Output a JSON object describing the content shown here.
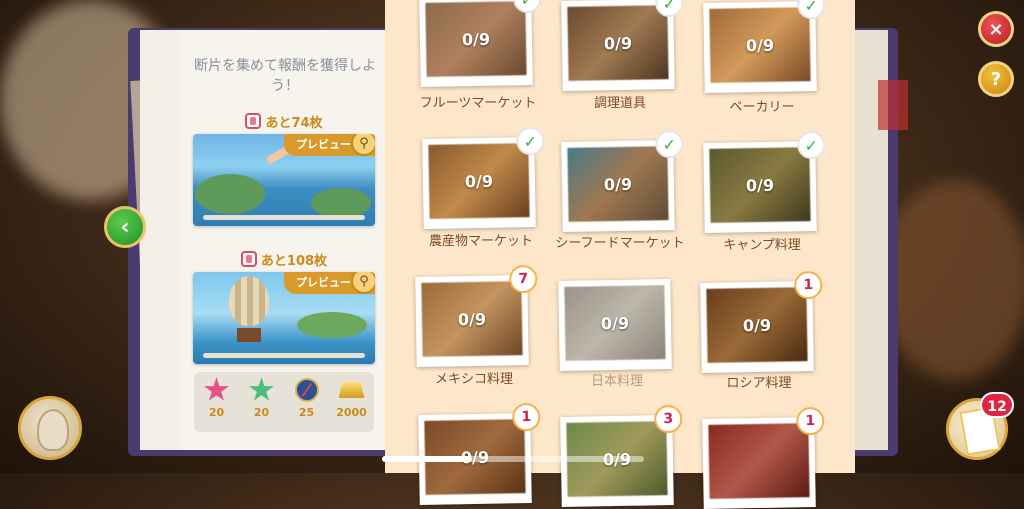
{
  "left_panel": {
    "heading": "断片を集めて報酬を獲得しよう！",
    "rewards": [
      {
        "remaining": "あと74枚",
        "preview_label": "プレビュー"
      },
      {
        "remaining": "あと108枚",
        "preview_label": "プレビュー"
      }
    ],
    "stats": [
      {
        "icon": "pink-star-icon",
        "value": "20"
      },
      {
        "icon": "green-star-icon",
        "value": "20"
      },
      {
        "icon": "compass-icon",
        "value": "25"
      },
      {
        "icon": "gold-bar-icon",
        "value": "2000"
      }
    ]
  },
  "album": {
    "tiles": [
      {
        "label": "フルーツマーケット",
        "count": "0/9",
        "badge": "check"
      },
      {
        "label": "調理道具",
        "count": "0/9",
        "badge": "check"
      },
      {
        "label": "ベーカリー",
        "count": "0/9",
        "badge": "check"
      },
      {
        "label": "農産物マーケット",
        "count": "0/9",
        "badge": "check"
      },
      {
        "label": "シーフードマーケット",
        "count": "0/9",
        "badge": "check"
      },
      {
        "label": "キャンプ料理",
        "count": "0/9",
        "badge": "check"
      },
      {
        "label": "メキシコ料理",
        "count": "0/9",
        "badge": "7"
      },
      {
        "label": "日本料理",
        "count": "0/9",
        "badge": ""
      },
      {
        "label": "ロシア料理",
        "count": "0/9",
        "badge": "1"
      },
      {
        "label": "",
        "count": "0/9",
        "badge": "1"
      },
      {
        "label": "",
        "count": "0/9",
        "badge": "3"
      },
      {
        "label": "",
        "count": "",
        "badge": "1"
      }
    ]
  },
  "buttons": {
    "back_icon": "‹",
    "close_icon": "×",
    "help_icon": "?",
    "cards_count": "12"
  },
  "colors": {
    "accent_gold": "#d99a2b",
    "check_green": "#35b44a",
    "badge_red": "#d0214a",
    "album_bg": "#fde6c9"
  }
}
